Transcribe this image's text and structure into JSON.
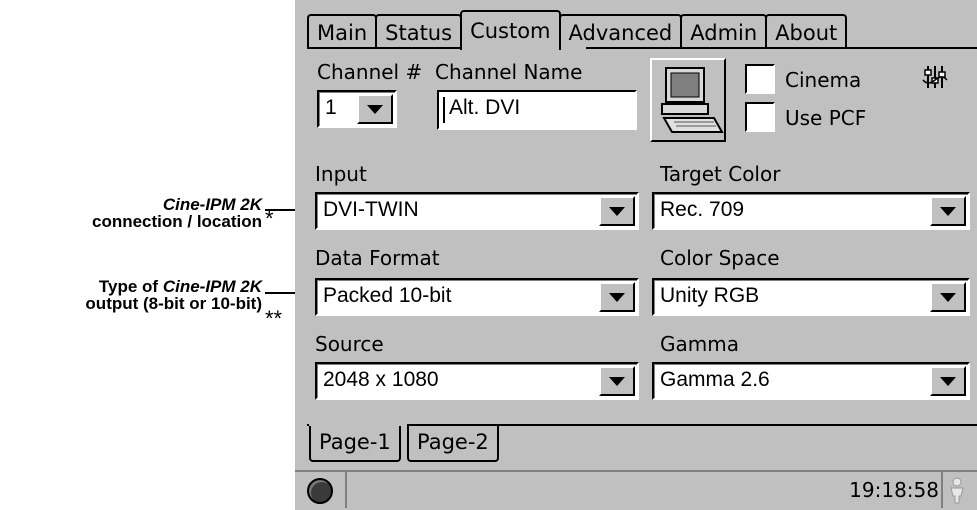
{
  "annotations": {
    "input_note": {
      "line1_em": "Cine-IPM 2K",
      "line2": "connection / location",
      "mark": "*"
    },
    "format_note": {
      "line1_prefix": "Type of ",
      "line1_em": "Cine-IPM 2K",
      "line2": "output (8-bit or 10-bit)",
      "mark": "**"
    }
  },
  "tabs": [
    "Main",
    "Status",
    "Custom",
    "Advanced",
    "Admin",
    "About"
  ],
  "active_tab": "Custom",
  "channel": {
    "label": "Channel #",
    "value": "1"
  },
  "channel_name": {
    "label": "Channel Name",
    "value": "Alt. DVI"
  },
  "checkboxes": {
    "cinema": "Cinema",
    "use_pcf": "Use PCF"
  },
  "input": {
    "label": "Input",
    "value": "DVI-TWIN"
  },
  "target_color": {
    "label": "Target Color",
    "value": "Rec. 709"
  },
  "data_format": {
    "label": "Data Format",
    "value": "Packed 10-bit"
  },
  "color_space": {
    "label": "Color Space",
    "value": "Unity RGB"
  },
  "source": {
    "label": "Source",
    "value": "2048 x 1080"
  },
  "gamma": {
    "label": "Gamma",
    "value": "Gamma 2.6"
  },
  "pages": [
    "Page-1",
    "Page-2"
  ],
  "status": {
    "time": "19:18:58"
  },
  "icons": [
    "computer-icon",
    "filter-settings-icon",
    "status-knob-icon",
    "person-icon"
  ]
}
